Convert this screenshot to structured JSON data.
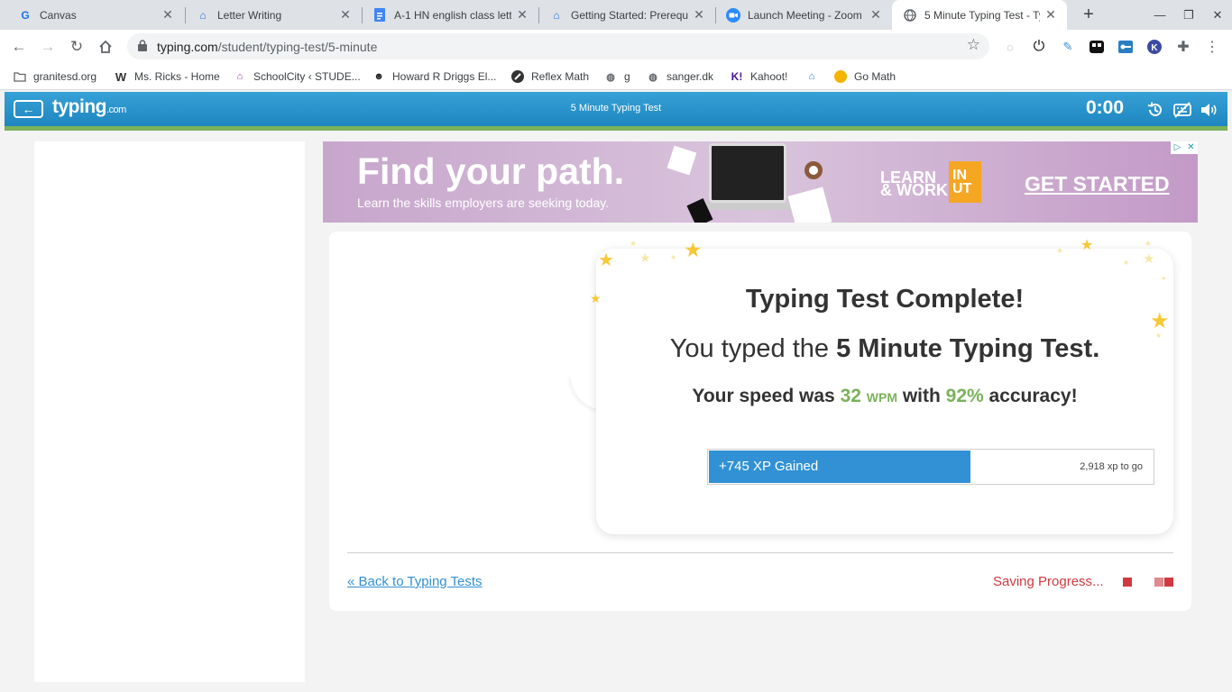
{
  "browser": {
    "tabs": [
      {
        "title": "Canvas",
        "icon": "canvas-g-icon"
      },
      {
        "title": "Letter Writing",
        "icon": "school-icon"
      },
      {
        "title": "A-1 HN english class lett",
        "icon": "docs-icon"
      },
      {
        "title": "Getting Started: Prerequi",
        "icon": "school-icon"
      },
      {
        "title": "Launch Meeting - Zoom",
        "icon": "zoom-icon"
      },
      {
        "title": "5 Minute Typing Test - Ty",
        "icon": "globe-icon",
        "active": true
      }
    ],
    "url_host": "typing.com",
    "url_path": "/student/typing-test/5-minute",
    "bookmarks": [
      {
        "label": "granitesd.org",
        "icon": "folder-icon"
      },
      {
        "label": "Ms. Ricks - Home",
        "icon": "weebly-icon"
      },
      {
        "label": "SchoolCity ‹ STUDE...",
        "icon": "schoolcity-icon"
      },
      {
        "label": "Howard R Driggs El...",
        "icon": "school-icon"
      },
      {
        "label": "Reflex Math",
        "icon": "reflex-icon"
      },
      {
        "label": "g",
        "icon": "globe-icon"
      },
      {
        "label": "sanger.dk",
        "icon": "globe-icon"
      },
      {
        "label": "Kahoot!",
        "icon": "kahoot-icon"
      },
      {
        "label": "",
        "icon": "school-icon"
      },
      {
        "label": "Go Math",
        "icon": "gomath-icon"
      }
    ]
  },
  "site": {
    "logo_main": "typing",
    "logo_suffix": ".com",
    "page_title": "5 Minute Typing Test",
    "timer": "0:00"
  },
  "ad": {
    "headline": "Find your path.",
    "subline": "Learn the skills employers are seeking today.",
    "learn": "LEARN",
    "work": "& WORK",
    "in": "IN",
    "ut": "UT",
    "cta": "GET STARTED"
  },
  "result": {
    "heading": "Typing Test Complete!",
    "typed_prefix": "You typed the ",
    "test_name": "5 Minute Typing Test.",
    "speed_prefix": "Your speed was ",
    "wpm_value": "32",
    "wpm_unit": "WPM",
    "speed_mid": " with ",
    "accuracy": "92%",
    "speed_suffix": " accuracy!",
    "xp_gained": "+745 XP Gained",
    "xp_to_go": "2,918 xp to go",
    "xp_progress_fraction": 0.59
  },
  "footer": {
    "back_link": "« Back to Typing Tests",
    "saving": "Saving Progress..."
  },
  "colors": {
    "header_blue": "#2a95cd",
    "accent_green": "#7ab25a",
    "xp_blue": "#3191d4",
    "saving_red": "#d0393f"
  }
}
